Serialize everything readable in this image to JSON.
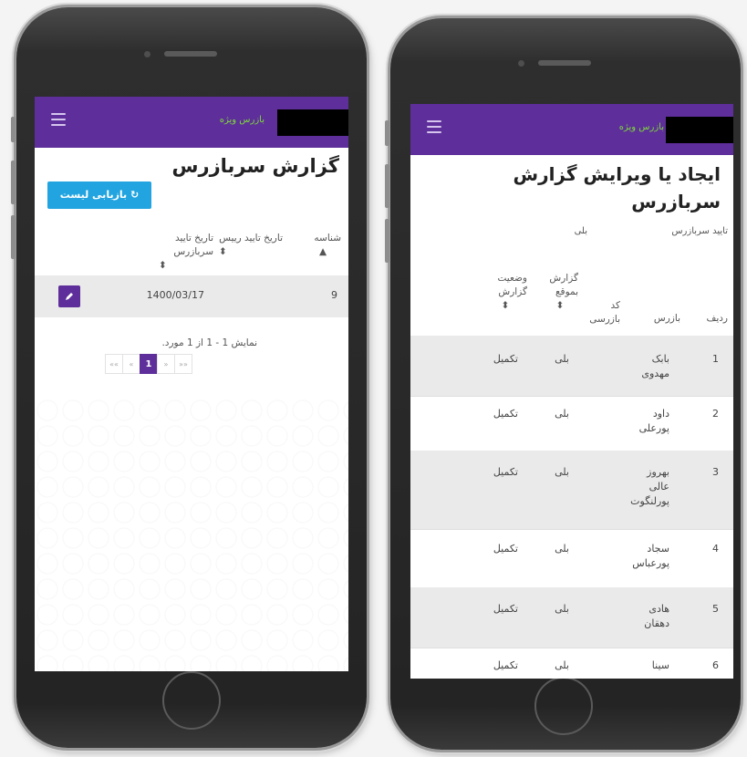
{
  "left_screen": {
    "navbar": {
      "brand": "بازرس ویژه"
    },
    "title": "گزارش سربازرس",
    "reset_button": "بازیابی لیست",
    "reset_icon": "refresh-icon",
    "columns": [
      "شناسه",
      "تاریخ تایید رییس",
      "تاریخ تایید سربازرس"
    ],
    "sort_icon": "sort-icon",
    "rows": [
      {
        "id": "9",
        "chief_date": "",
        "inspector_date": "1400/03/17"
      }
    ],
    "summary": "نمایش 1 - 1 از 1 مورد.",
    "pagination": [
      "««",
      "«",
      "1",
      "»",
      "»»"
    ],
    "current_page": "1",
    "accent": "#5e2e9a",
    "button_color": "#21a4df"
  },
  "right_screen": {
    "navbar": {
      "brand": "بازرس ویژه"
    },
    "title": "ایجاد یا ویرایش گزارش سربازرس",
    "approve_label": "تایید سربازرس",
    "approve_value": "بلی",
    "columns": [
      "ردیف",
      "بازرس",
      "کد بازرسی",
      "گزارش بموقع",
      "وضعیت گزارش"
    ],
    "rows": [
      {
        "n": "1",
        "inspector": "بابک مهدوی",
        "code": "",
        "ontime": "بلی",
        "status": "تکمیل"
      },
      {
        "n": "2",
        "inspector": "داود پورعلی",
        "code": "",
        "ontime": "بلی",
        "status": "تکمیل"
      },
      {
        "n": "3",
        "inspector": "بهروز عالی پورلنگوت",
        "code": "",
        "ontime": "بلی",
        "status": "تکمیل"
      },
      {
        "n": "4",
        "inspector": "سجاد پورعباس",
        "code": "",
        "ontime": "بلی",
        "status": "تکمیل"
      },
      {
        "n": "5",
        "inspector": "هادی دهقان",
        "code": "",
        "ontime": "بلی",
        "status": "تکمیل"
      },
      {
        "n": "6",
        "inspector": "سینا",
        "code": "",
        "ontime": "بلی",
        "status": "تکمیل"
      }
    ]
  }
}
